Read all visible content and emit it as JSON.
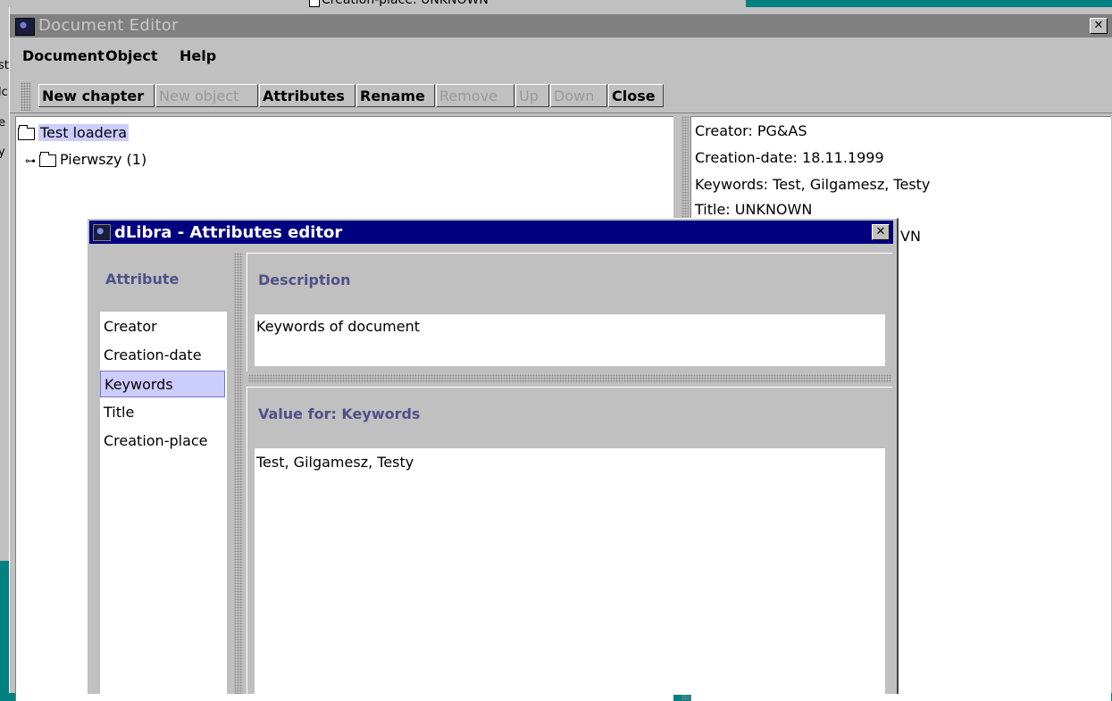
{
  "background_window": {
    "text": "Creation-place: UNKNOWN"
  },
  "left_strip_chars": [
    "st",
    "lc",
    "e",
    "y"
  ],
  "main_window": {
    "title": "Document Editor",
    "close_glyph": "✕",
    "menu": [
      "Document",
      "Object",
      "Help"
    ],
    "toolbar": [
      {
        "label": "New chapter",
        "enabled": true
      },
      {
        "label": "New object",
        "enabled": false
      },
      {
        "label": "Attributes",
        "enabled": true
      },
      {
        "label": "Rename",
        "enabled": true
      },
      {
        "label": "Remove",
        "enabled": false
      },
      {
        "label": "Up",
        "enabled": false
      },
      {
        "label": "Down",
        "enabled": false
      },
      {
        "label": "Close",
        "enabled": true
      }
    ],
    "tree": {
      "root": "Test loadera",
      "child": "Pierwszy (1)"
    },
    "properties": [
      "Creator: PG&AS",
      "Creation-date: 18.11.1999",
      "Keywords: Test, Gilgamesz, Testy",
      "Title: UNKNOWN",
      "VN"
    ]
  },
  "dialog": {
    "title": "dLibra - Attributes editor",
    "close_glyph": "✕",
    "attribute_header": "Attribute",
    "attributes": [
      "Creator",
      "Creation-date",
      "Keywords",
      "Title",
      "Creation-place"
    ],
    "selected_attribute": "Keywords",
    "description_header": "Description",
    "description_text": "Keywords of document",
    "value_header": "Value for: Keywords",
    "value_text": "Test, Gilgamesz, Testy"
  },
  "colors": {
    "desktop": "#008080",
    "dialog_title": "#000080",
    "selection": "#ccccff",
    "header_text": "#50508a"
  }
}
